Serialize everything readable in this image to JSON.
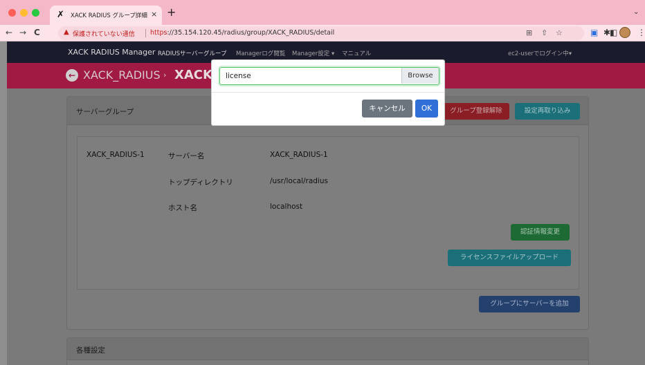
{
  "browser": {
    "tab_title": "XACK RADIUS グループ詳細",
    "tab_close": "×",
    "new_tab": "+",
    "tabs_menu": "⌄",
    "nav_back": "←",
    "nav_forward": "→",
    "nav_reload": "C",
    "security_warning": "保護されていない通信",
    "url_scheme": "https",
    "url_rest": "://35.154.120.45/radius/group/XACK_RADIUS/detail"
  },
  "app": {
    "brand": "XACK RADIUS Manager",
    "nav": [
      {
        "label": "RADIUSサーバーグループ"
      },
      {
        "label": "Managerログ閲覧"
      },
      {
        "label": "Manager設定 ▾"
      },
      {
        "label": "マニュアル"
      }
    ],
    "login": "ec2-userでログイン中▾"
  },
  "breadcrumb": {
    "root": "XACK_RADIUS",
    "arrow": "›",
    "current": "XACK_RADIUS"
  },
  "server_group": {
    "title": "サーバーグループ",
    "unregister_label": "グループ登録解除",
    "reload_label": "設定再取り込み",
    "server": {
      "name": "XACK_RADIUS-1",
      "fields": [
        {
          "label": "サーバー名",
          "value": "XACK_RADIUS-1"
        },
        {
          "label": "トップディレクトリ",
          "value": "/usr/local/radius"
        },
        {
          "label": "ホスト名",
          "value": "localhost"
        }
      ],
      "change_auth_label": "認証情報変更",
      "license_upload_label": "ライセンスファイルアップロード"
    },
    "add_server_label": "グループにサーバーを追加"
  },
  "settings": {
    "title": "各種設定"
  },
  "modal": {
    "file_value": "license",
    "browse_label": "Browse",
    "cancel_label": "キャンセル",
    "ok_label": "OK"
  }
}
